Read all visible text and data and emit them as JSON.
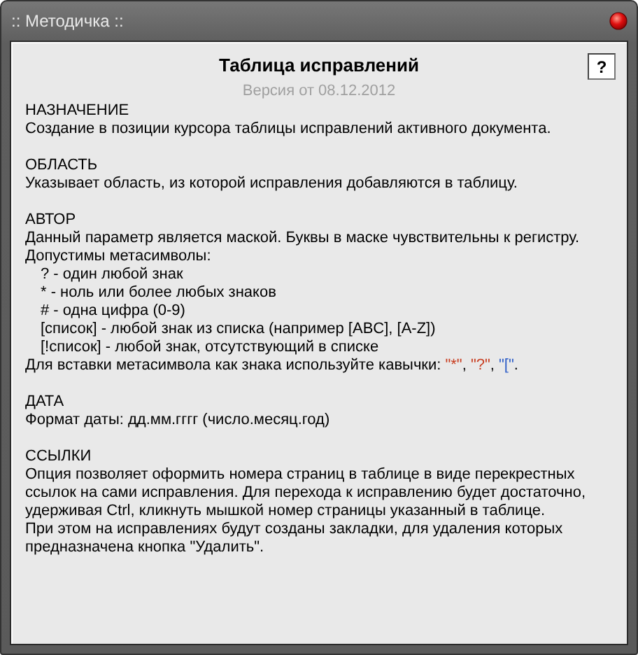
{
  "window": {
    "title": ":: Методичка ::"
  },
  "help_button": {
    "label": "?"
  },
  "document": {
    "title": "Таблица исправлений",
    "version": "Версия от 08.12.2012",
    "sections": [
      {
        "heading": "НАЗНАЧЕНИЕ",
        "lines": [
          {
            "kind": "plain",
            "text": "Создание в позиции курсора таблицы исправлений активного документа."
          }
        ]
      },
      {
        "heading": "ОБЛАСТЬ",
        "lines": [
          {
            "kind": "plain",
            "text": "Указывает область, из которой исправления добавляются в таблицу."
          }
        ]
      },
      {
        "heading": "АВТОР",
        "lines": [
          {
            "kind": "plain",
            "text": "Данный параметр является маской. Буквы в маске чувствительны к регистру."
          },
          {
            "kind": "plain",
            "text": "Допустимы метасимволы:"
          },
          {
            "kind": "indent",
            "text": "? - один любой знак"
          },
          {
            "kind": "indent",
            "text": "* - ноль или более любых знаков"
          },
          {
            "kind": "indent",
            "text": "# - одна цифра (0-9)"
          },
          {
            "kind": "indent",
            "text": "[список] - любой знак из списка (например [ABC], [A-Z])"
          },
          {
            "kind": "indent",
            "text": "[!список] - любой знак, отсутствующий в списке"
          },
          {
            "kind": "parts",
            "parts": [
              {
                "text": "Для вставки метасимвола как знака используйте кавычки: "
              },
              {
                "text": "\"*\"",
                "color": "#c83c1e"
              },
              {
                "text": ", "
              },
              {
                "text": "\"?\"",
                "color": "#c83c1e"
              },
              {
                "text": ", "
              },
              {
                "text": "\"[\"",
                "color": "#2f5fc8"
              },
              {
                "text": "."
              }
            ]
          }
        ]
      },
      {
        "heading": "ДАТА",
        "lines": [
          {
            "kind": "plain",
            "text": "Формат даты: дд.мм.гггг (число.месяц.год)"
          }
        ]
      },
      {
        "heading": "ССЫЛКИ",
        "lines": [
          {
            "kind": "plain",
            "text": "Опция позволяет оформить номера страниц в таблице в виде перекрестных"
          },
          {
            "kind": "plain",
            "text": "ссылок на сами исправления. Для перехода к исправлению будет достаточно,"
          },
          {
            "kind": "plain",
            "text": "удерживая Ctrl, кликнуть мышкой номер страницы указанный в таблице."
          },
          {
            "kind": "plain",
            "text": "При этом на исправлениях будут созданы закладки, для удаления которых"
          },
          {
            "kind": "plain",
            "text": "предназначена кнопка \"Удалить\"."
          }
        ]
      }
    ]
  }
}
